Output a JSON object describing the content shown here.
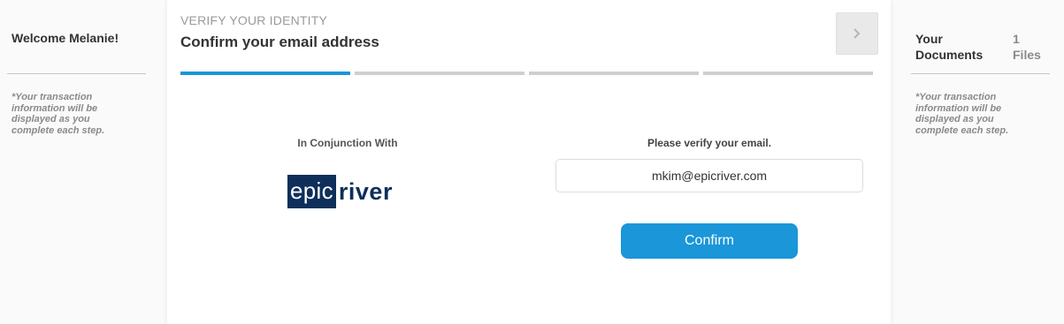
{
  "left_sidebar": {
    "welcome": "Welcome Melanie!",
    "note": "*Your transaction information will be displayed as you complete each step."
  },
  "main": {
    "step_label": "VERIFY YOUR IDENTITY",
    "step_title": "Confirm your email address",
    "next_icon": "chevron-right-icon",
    "progress": {
      "total_steps": 4,
      "current_step": 1
    },
    "partner": {
      "label": "In Conjunction With",
      "logo_box_text": "epic",
      "logo_text": "river"
    },
    "verify": {
      "label": "Please verify your email.",
      "email_value": "mkim@epicriver.com",
      "confirm_label": "Confirm"
    }
  },
  "right_sidebar": {
    "title": "Your Documents",
    "count": "1 Files",
    "note": "*Your transaction information will be displayed as you complete each step."
  },
  "colors": {
    "accent": "#1a96d9",
    "logo_navy": "#0e2f5a",
    "progress_inactive": "#cfcfcf"
  }
}
